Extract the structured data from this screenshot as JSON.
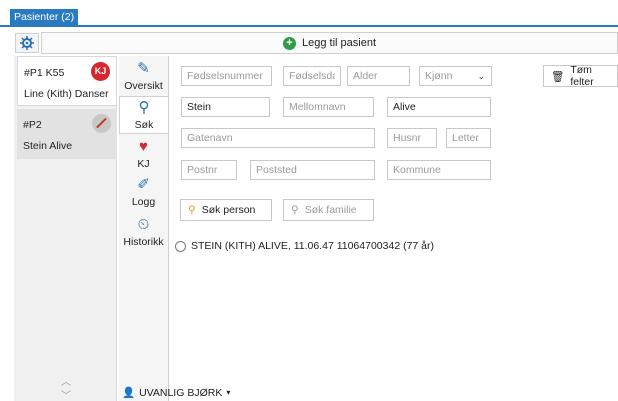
{
  "tabs": {
    "patients_tab": "Pasienter (2)"
  },
  "toolbar": {
    "add_patient_label": "Legg til pasient"
  },
  "patients": [
    {
      "id": "#P1 K55",
      "name": "Line (Kith) Danser",
      "badge": "KJ"
    },
    {
      "id": "#P2",
      "name": "Stein Alive",
      "badge": ""
    }
  ],
  "nav": {
    "oversikt": "Oversikt",
    "sok": "Søk",
    "kj": "KJ",
    "logg": "Logg",
    "historikk": "Historikk"
  },
  "form": {
    "fodselsnummer": {
      "value": "",
      "placeholder": "Fødselsnummer"
    },
    "fodselsdato": {
      "value": "",
      "placeholder": "Fødselsdat"
    },
    "alder": {
      "value": "",
      "placeholder": "Alder"
    },
    "kjonn": {
      "selected": "Kjønn"
    },
    "fornavn": {
      "value": "Stein",
      "placeholder": ""
    },
    "mellomnavn": {
      "value": "",
      "placeholder": "Mellomnavn"
    },
    "etternavn": {
      "value": "Alive",
      "placeholder": ""
    },
    "gatenavn": {
      "value": "",
      "placeholder": "Gatenavn"
    },
    "husnr": {
      "value": "",
      "placeholder": "Husnr"
    },
    "letter": {
      "value": "",
      "placeholder": "Letter"
    },
    "postnr": {
      "value": "",
      "placeholder": "Postnr"
    },
    "poststed": {
      "value": "",
      "placeholder": "Poststed"
    },
    "kommune": {
      "value": "",
      "placeholder": "Kommune"
    },
    "tom_felter_label": "Tøm felter",
    "sok_person_label": "Søk person",
    "sok_familie_label": "Søk familie"
  },
  "results": [
    {
      "text": "STEIN (KITH) ALIVE, 11.06.47 11064700342 (77 år)"
    }
  ],
  "status": {
    "user": "UVANLIG BJØRK"
  },
  "colors": {
    "accent": "#2a7ac2",
    "add_green": "#2e9a4a",
    "badge_red": "#d7262e"
  }
}
